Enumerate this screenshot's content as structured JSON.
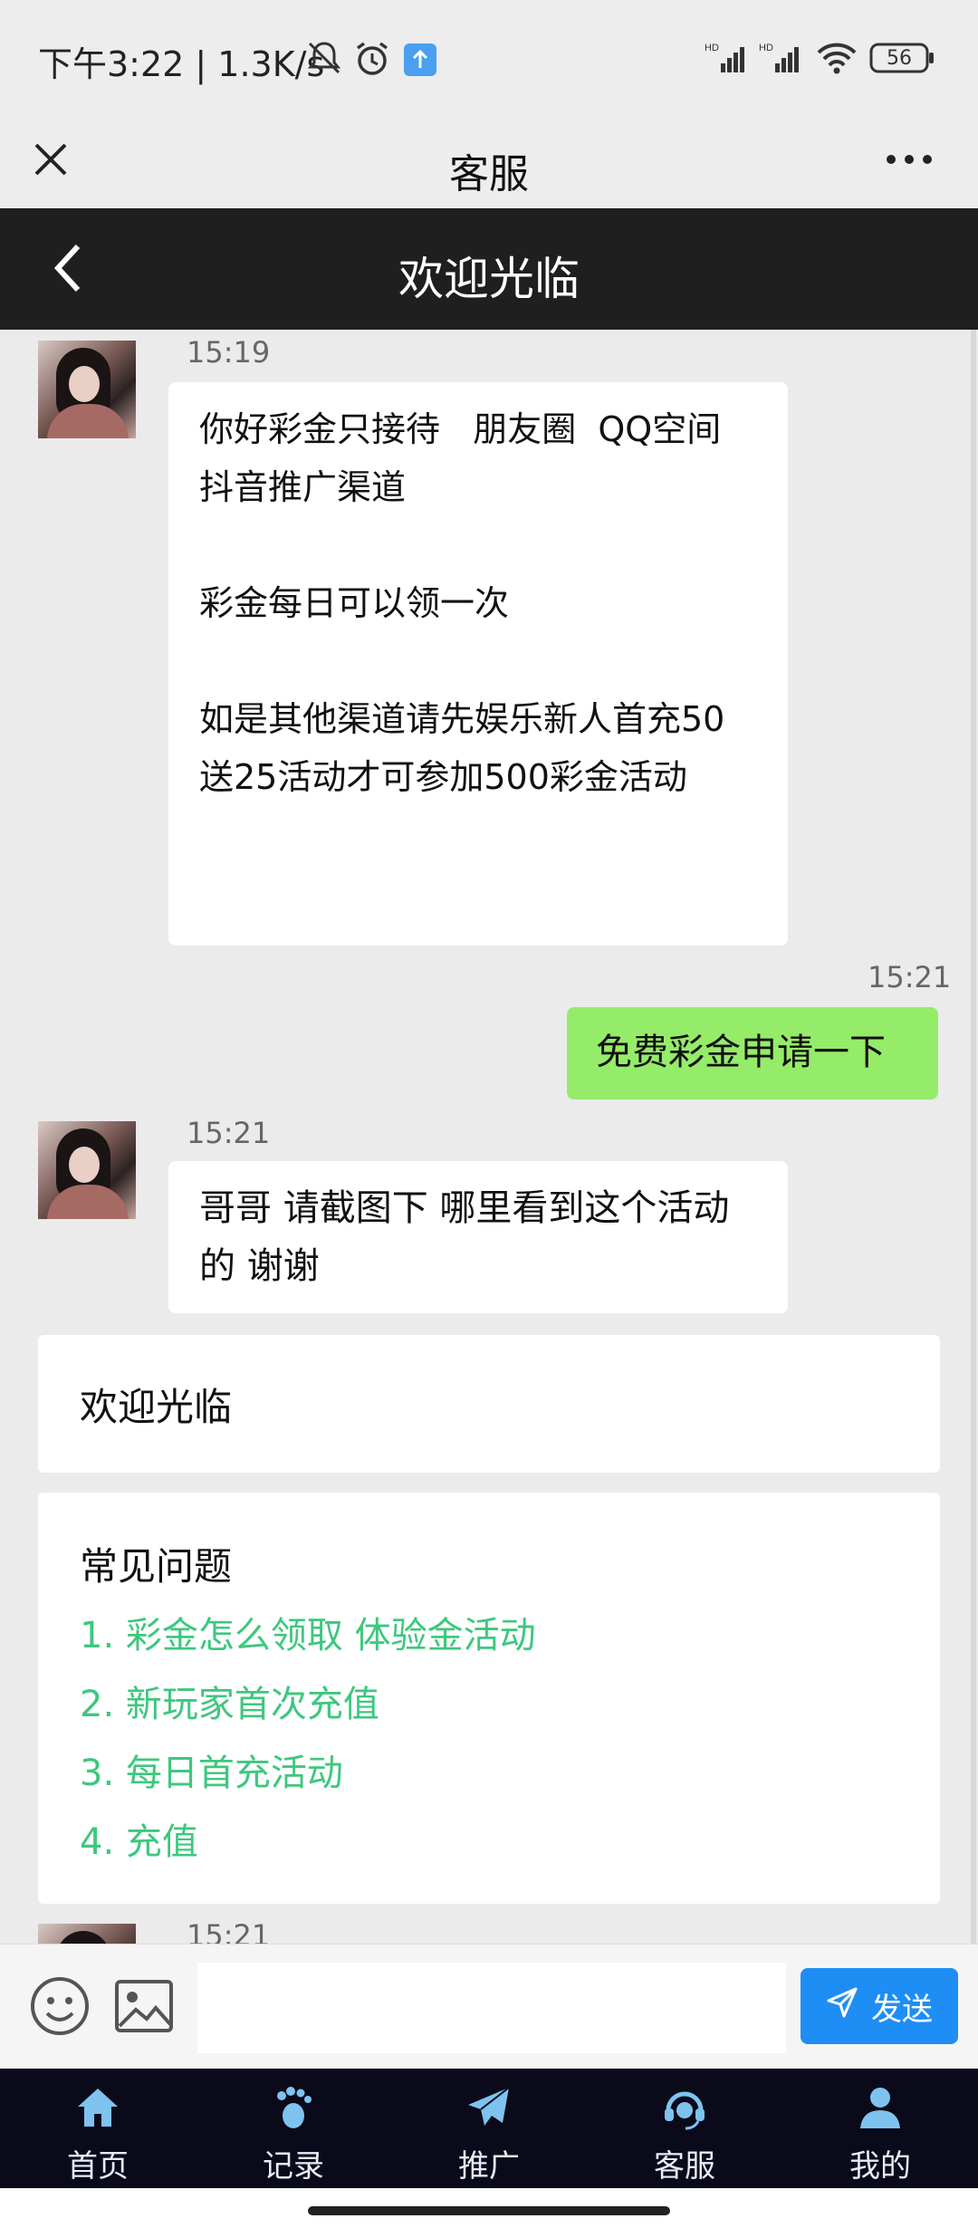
{
  "status_bar": {
    "time_and_speed": "下午3:22 | 1.3K/s",
    "battery": "56"
  },
  "titlebar": {
    "title": "客服"
  },
  "app_header": {
    "title": "欢迎光临"
  },
  "chat": {
    "messages": [
      {
        "time": "15:19",
        "text": "你好彩金只接待   朋友圈  QQ空间 抖音推广渠道\n\n彩金每日可以领一次\n\n如是其他渠道请先娱乐新人首充50送25活动才可参加500彩金活动"
      },
      {
        "time": "15:21",
        "text": "免费彩金申请一下"
      },
      {
        "time": "15:21",
        "text": "哥哥 请截图下 哪里看到这个活动的 谢谢"
      },
      {
        "time": "15:21"
      }
    ],
    "welcome_card": "欢迎光临",
    "faq": {
      "title": "常见问题",
      "items": [
        "1. 彩金怎么领取 体验金活动",
        "2. 新玩家首次充值",
        "3. 每日首充活动",
        "4. 充值"
      ]
    }
  },
  "input_bar": {
    "send_label": "发送",
    "placeholder": ""
  },
  "bottom_nav": {
    "items": [
      {
        "label": "首页",
        "icon": "home-icon"
      },
      {
        "label": "记录",
        "icon": "footprint-icon"
      },
      {
        "label": "推广",
        "icon": "paper-plane-icon"
      },
      {
        "label": "客服",
        "icon": "headset-icon"
      },
      {
        "label": "我的",
        "icon": "user-icon"
      }
    ]
  },
  "colors": {
    "header_bg": "#1f1f1f",
    "own_bubble": "#95ec69",
    "faq_link": "#3ec77e",
    "send_button": "#1e8ef5",
    "nav_bg": "#0a0a1a"
  }
}
